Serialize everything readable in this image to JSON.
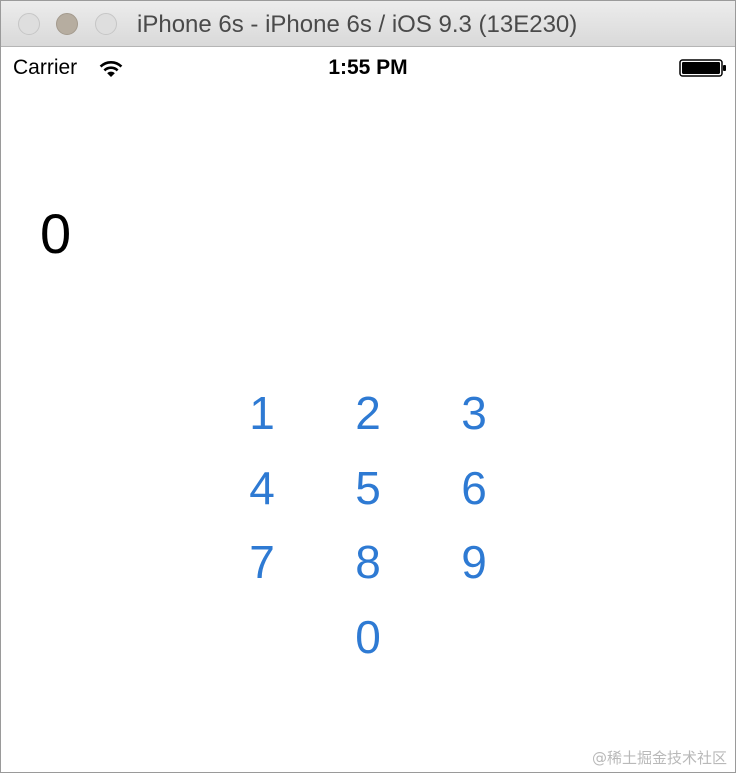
{
  "window": {
    "title": "iPhone 6s - iPhone 6s / iOS 9.3 (13E230)"
  },
  "statusbar": {
    "carrier": "Carrier",
    "time": "1:55 PM",
    "icons": [
      "wifi-icon",
      "battery-icon"
    ]
  },
  "display": {
    "value": "0"
  },
  "keypad": {
    "keys": [
      "1",
      "2",
      "3",
      "4",
      "5",
      "6",
      "7",
      "8",
      "9",
      "0"
    ]
  },
  "watermark": "@稀土掘金技术社区",
  "colors": {
    "accent": "#2e7ad3",
    "text": "#000000",
    "background": "#ffffff"
  }
}
